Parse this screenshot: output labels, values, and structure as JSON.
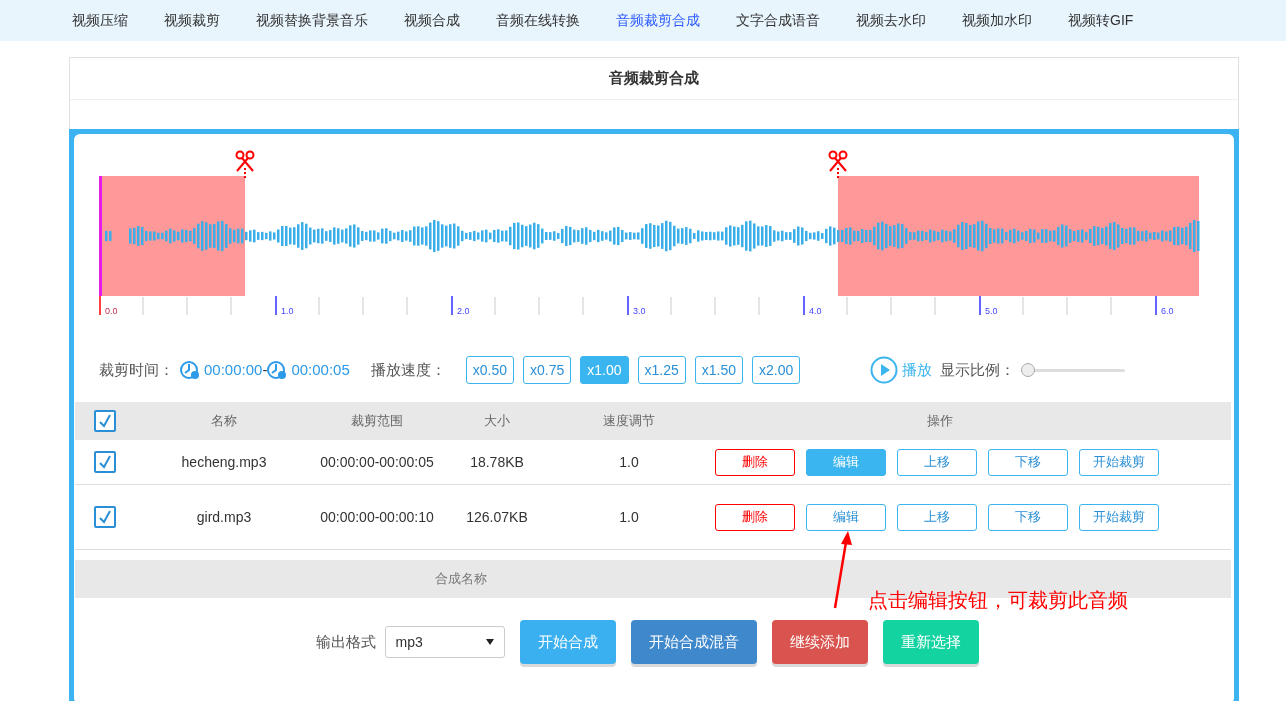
{
  "nav": [
    {
      "label": "视频压缩",
      "selected": false
    },
    {
      "label": "视频裁剪",
      "selected": false
    },
    {
      "label": "视频替换背景音乐",
      "selected": false
    },
    {
      "label": "视频合成",
      "selected": false
    },
    {
      "label": "音频在线转换",
      "selected": false
    },
    {
      "label": "音频裁剪合成",
      "selected": true
    },
    {
      "label": "文字合成语音",
      "selected": false
    },
    {
      "label": "视频去水印",
      "selected": false
    },
    {
      "label": "视频加水印",
      "selected": false
    },
    {
      "label": "视频转GIF",
      "selected": false
    }
  ],
  "title": "音频裁剪合成",
  "timeline": {
    "ticks": [
      "0.0",
      "1.0",
      "2.0",
      "3.0",
      "4.0",
      "5.0",
      "6.0"
    ]
  },
  "trim": {
    "label": "裁剪时间：",
    "start": "00:00:00",
    "separator": "-",
    "end": "00:00:05"
  },
  "speed": {
    "label": "播放速度：",
    "options": [
      {
        "label": "x0.50",
        "selected": false
      },
      {
        "label": "x0.75",
        "selected": false
      },
      {
        "label": "x1.00",
        "selected": true
      },
      {
        "label": "x1.25",
        "selected": false
      },
      {
        "label": "x1.50",
        "selected": false
      },
      {
        "label": "x2.00",
        "selected": false
      }
    ]
  },
  "play": {
    "label": "播放"
  },
  "zoom": {
    "label": "显示比例：",
    "level": 0
  },
  "table": {
    "all_checked": true,
    "columns": [
      "名称",
      "裁剪范围",
      "大小",
      "速度调节",
      "操作"
    ],
    "rows": [
      {
        "checked": true,
        "name": "hecheng.mp3",
        "range": "00:00:00-00:00:05",
        "size": "18.78KB",
        "speed": "1.0",
        "actions": [
          {
            "label": "删除",
            "kind": "danger"
          },
          {
            "label": "编辑",
            "kind": "filled"
          },
          {
            "label": "上移",
            "kind": "outline"
          },
          {
            "label": "下移",
            "kind": "outline"
          },
          {
            "label": "开始裁剪",
            "kind": "outline"
          }
        ]
      },
      {
        "checked": true,
        "name": "gird.mp3",
        "range": "00:00:00-00:00:10",
        "size": "126.07KB",
        "speed": "1.0",
        "actions": [
          {
            "label": "删除",
            "kind": "danger"
          },
          {
            "label": "编辑",
            "kind": "outline"
          },
          {
            "label": "上移",
            "kind": "outline"
          },
          {
            "label": "下移",
            "kind": "outline"
          },
          {
            "label": "开始裁剪",
            "kind": "outline"
          }
        ]
      }
    ]
  },
  "compose_name": {
    "label": "合成名称"
  },
  "output": {
    "label": "输出格式",
    "value": "mp3"
  },
  "buttons": [
    {
      "label": "开始合成",
      "color": "#3bb0f0"
    },
    {
      "label": "开始合成混音",
      "color": "#3f88cc"
    },
    {
      "label": "继续添加",
      "color": "#d9534f"
    },
    {
      "label": "重新选择",
      "color": "#13d3a0"
    }
  ],
  "annotation": {
    "text": "点击编辑按钮，可裁剪此音频"
  }
}
